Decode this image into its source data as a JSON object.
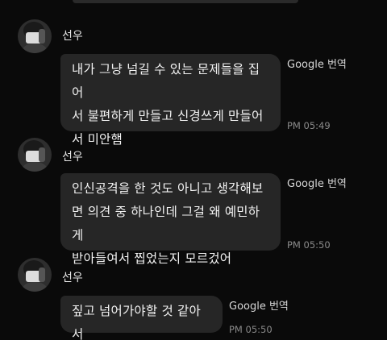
{
  "messages": [
    {
      "sender": "선우",
      "text": "내가 그냥 넘길 수 있는 문제들을 집어\n서 불편하게 만들고 신경쓰게 만들어\n서 미안햄",
      "translate_label": "Google 번역",
      "time": "PM 05:49"
    },
    {
      "sender": "선우",
      "text": "인신공격을 한 것도 아니고 생각해보\n면 의견 중 하나인데 그걸 왜 예민하게\n받아들여서 찝었는지 모르겄어",
      "translate_label": "Google 번역",
      "time": "PM 05:50"
    },
    {
      "sender": "선우",
      "text": "짚고 넘어가야할 것 같아서",
      "translate_label": "Google 번역",
      "time": "PM 05:50"
    }
  ],
  "icons": {
    "avatar": "avatar-photo",
    "translate": "google-translate"
  },
  "colors": {
    "background": "#0a0a0a",
    "bubble": "#262626",
    "text": "#f2f2f2",
    "time": "#8a8a8a"
  }
}
